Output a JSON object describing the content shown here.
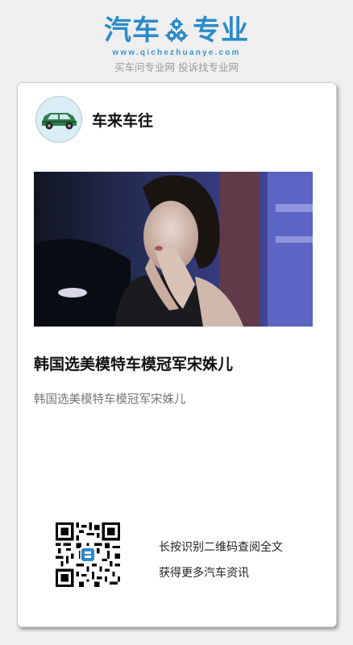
{
  "logo": {
    "left_text": "汽车",
    "right_text": "专业",
    "url": "www.qichezhuanye.com",
    "slogan": "买车问专业网 投诉找专业网",
    "color": "#2a8bc9",
    "icon": "gears-icon"
  },
  "author": {
    "name": "车来车往",
    "avatar_icon": "green-car-icon"
  },
  "article": {
    "photo_icon": "car-show-model-photo",
    "title": "韩国选美模特车模冠军宋姝儿",
    "description": "韩国选美模特车模冠军宋姝儿"
  },
  "qr": {
    "icon": "qr-code-icon",
    "line1": "长按识别二维码查阅全文",
    "line2": "获得更多汽车资讯"
  }
}
